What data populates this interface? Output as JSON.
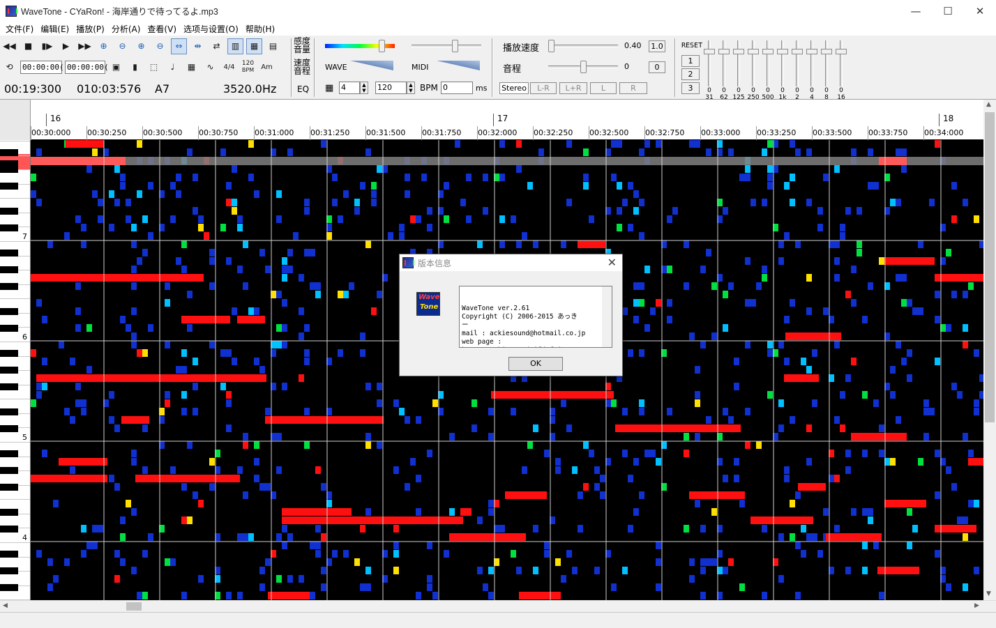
{
  "window": {
    "title": "WaveTone - CYaRon! - 海岸通りで待ってるよ.mp3",
    "minimize": "—",
    "maximize": "☐",
    "close": "✕"
  },
  "menu": [
    "文件(F)",
    "编辑(E)",
    "播放(P)",
    "分析(A)",
    "查看(V)",
    "选项与设置(O)",
    "帮助(H)"
  ],
  "toolbar": {
    "time_start": "00:00:00(",
    "time_end": "00:00:00(",
    "meter": "4/4",
    "bpm_badge": "120",
    "bpm_badge_label": "BPM",
    "chord_label": "Am"
  },
  "status": {
    "position_time": "00:19:300",
    "bar_time": "010:03:576",
    "note": "A7",
    "frequency": "3520.0Hz"
  },
  "controls": {
    "sensitivity_label_1": "感度",
    "sensitivity_label_2": "音量",
    "speed_label_1": "速度",
    "speed_label_2": "音程",
    "eq_label": "EQ",
    "wave_label": "WAVE",
    "midi_label": "MIDI",
    "beats_value": "4",
    "bpm_value": "120",
    "bpm_unit": "BPM",
    "offset_value": "0",
    "offset_unit": "ms",
    "playback_speed_label": "播放速度",
    "playback_speed_value": "0.40",
    "playback_speed_reset": "1.0",
    "pitch_label": "音程",
    "pitch_value": "0",
    "pitch_reset": "0",
    "stereo_buttons": [
      "Stereo",
      "L-R",
      "L+R",
      "L",
      "R"
    ]
  },
  "eq": {
    "reset": "RESET",
    "presets": [
      "1",
      "2",
      "3"
    ],
    "values": [
      "0",
      "0",
      "0",
      "0",
      "0",
      "0",
      "0",
      "0",
      "0",
      "0"
    ],
    "frequencies": [
      "31",
      "62",
      "125",
      "250",
      "500",
      "1k",
      "2",
      "4",
      "8",
      "16"
    ]
  },
  "ruler": {
    "bars": [
      {
        "label": "16"
      },
      {
        "label": "17"
      },
      {
        "label": "18"
      }
    ],
    "times": [
      "00:30:000",
      "00:30:250",
      "00:30:500",
      "00:30:750",
      "00:31:000",
      "00:31:250",
      "00:31:500",
      "00:31:750",
      "00:32:000",
      "00:32:250",
      "00:32:500",
      "00:32:750",
      "00:33:000",
      "00:33:250",
      "00:33:500",
      "00:33:750",
      "00:34:000"
    ]
  },
  "keyboard": {
    "octave_labels": [
      "7",
      "6",
      "5",
      "4"
    ]
  },
  "dialog": {
    "title": "版本信息",
    "close": "✕",
    "logo_text_1": "Wave",
    "logo_text_2": "Tone",
    "info_text": "WaveTone ver.2.61\nCopyright (C) 2006-2015 あっき\nー\nmail : ackiesound@hotmail.co.jp\nweb page :\nhttp://ackiesound.ifdef.jp/",
    "ok": "OK"
  },
  "colors": {
    "spectrogram_bg": "#000000",
    "hot": "#ff1010",
    "warm": "#ffe000",
    "mid": "#00e040",
    "cool": "#00c0ff",
    "cold": "#1030d0"
  }
}
